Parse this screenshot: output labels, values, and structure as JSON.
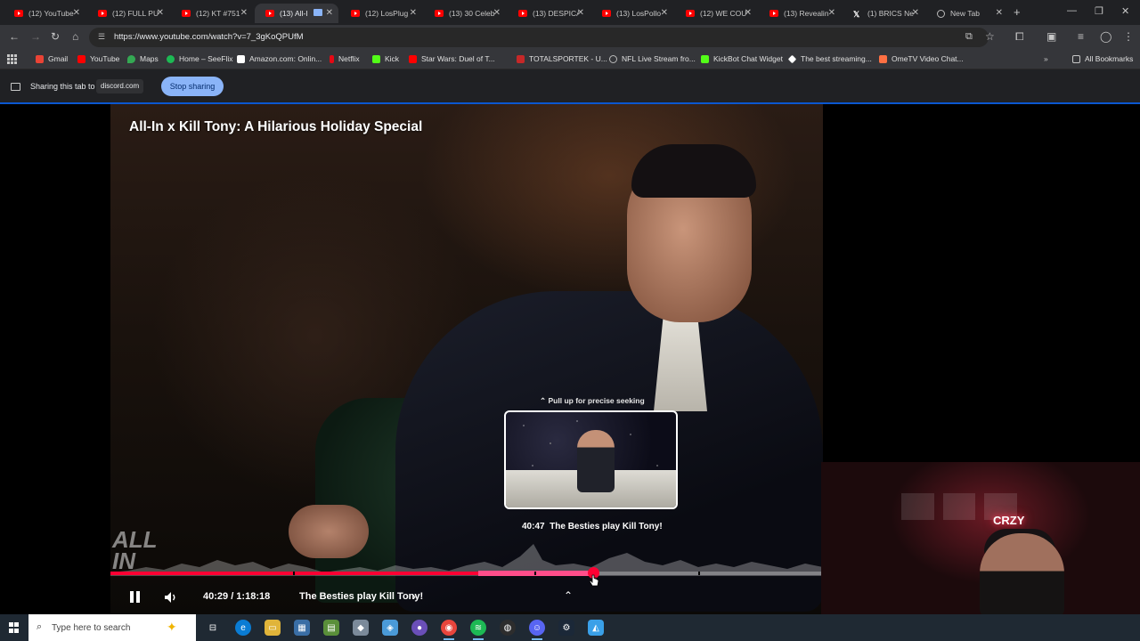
{
  "browser": {
    "tabs": [
      {
        "title": "(12) YouTube",
        "icon": "youtube-icon"
      },
      {
        "title": "(12) FULL PU",
        "icon": "youtube-icon"
      },
      {
        "title": "(12) KT #751",
        "icon": "youtube-icon"
      },
      {
        "title": "(13) All-I",
        "icon": "youtube-icon",
        "active": true
      },
      {
        "title": "(12) LosPlug",
        "icon": "youtube-icon"
      },
      {
        "title": "(13) 30 Celeb",
        "icon": "youtube-icon"
      },
      {
        "title": "(13) DESPICA",
        "icon": "youtube-icon"
      },
      {
        "title": "(13) LosPollo",
        "icon": "youtube-icon"
      },
      {
        "title": "(12) WE COU",
        "icon": "youtube-icon"
      },
      {
        "title": "(13) Revealin",
        "icon": "youtube-icon"
      },
      {
        "title": "(1) BRICS Ne",
        "icon": "x-logo-icon"
      },
      {
        "title": "New Tab",
        "icon": "chrome-icon"
      }
    ],
    "url": "https://www.youtube.com/watch?v=7_3gKoQPUfM",
    "bookmarks": [
      {
        "label": "Gmail",
        "color": "#ea4335"
      },
      {
        "label": "YouTube",
        "color": "#ff0000"
      },
      {
        "label": "Maps",
        "color": "#34a853"
      },
      {
        "label": "Home – SeeFlix",
        "color": "#1db954"
      },
      {
        "label": "Amazon.com: Onlin...",
        "color": "#ff9900"
      },
      {
        "label": "Netflix",
        "color": "#e50914"
      },
      {
        "label": "Kick",
        "color": "#53fc18"
      },
      {
        "label": "Star Wars: Duel of T...",
        "color": "#ff0000"
      },
      {
        "label": "TOTALSPORTEK - U...",
        "color": "#c62828"
      },
      {
        "label": "NFL Live Stream fro...",
        "color": "#9e9e9e"
      },
      {
        "label": "KickBot Chat Widget",
        "color": "#53fc18"
      },
      {
        "label": "The best streaming...",
        "color": "#ffffff"
      },
      {
        "label": "OmeTV Video Chat...",
        "color": "#ff7043"
      }
    ],
    "all_bookmarks": "All Bookmarks",
    "share": {
      "text": "Sharing this tab to",
      "target": "discord.com",
      "stop_label": "Stop sharing"
    }
  },
  "video": {
    "title": "All-In x Kill Tony: A Hilarious Holiday Special",
    "seek_hint": "Pull up for precise seeking",
    "preview_time": "40:47",
    "preview_chapter": "The Besties play Kill Tony!",
    "time_display": "40:29 / 1:18:18",
    "chapter": "The Besties play Kill Tony!",
    "progress_fraction": 0.517,
    "hover_fraction": 0.679,
    "logo_text": "ALL IN"
  },
  "webcam": {
    "neon_sign": "CRZY"
  },
  "taskbar": {
    "search_placeholder": "Type here to search"
  },
  "colors": {
    "accent_red": "#ff0033",
    "share_button": "#8ab4f8"
  }
}
